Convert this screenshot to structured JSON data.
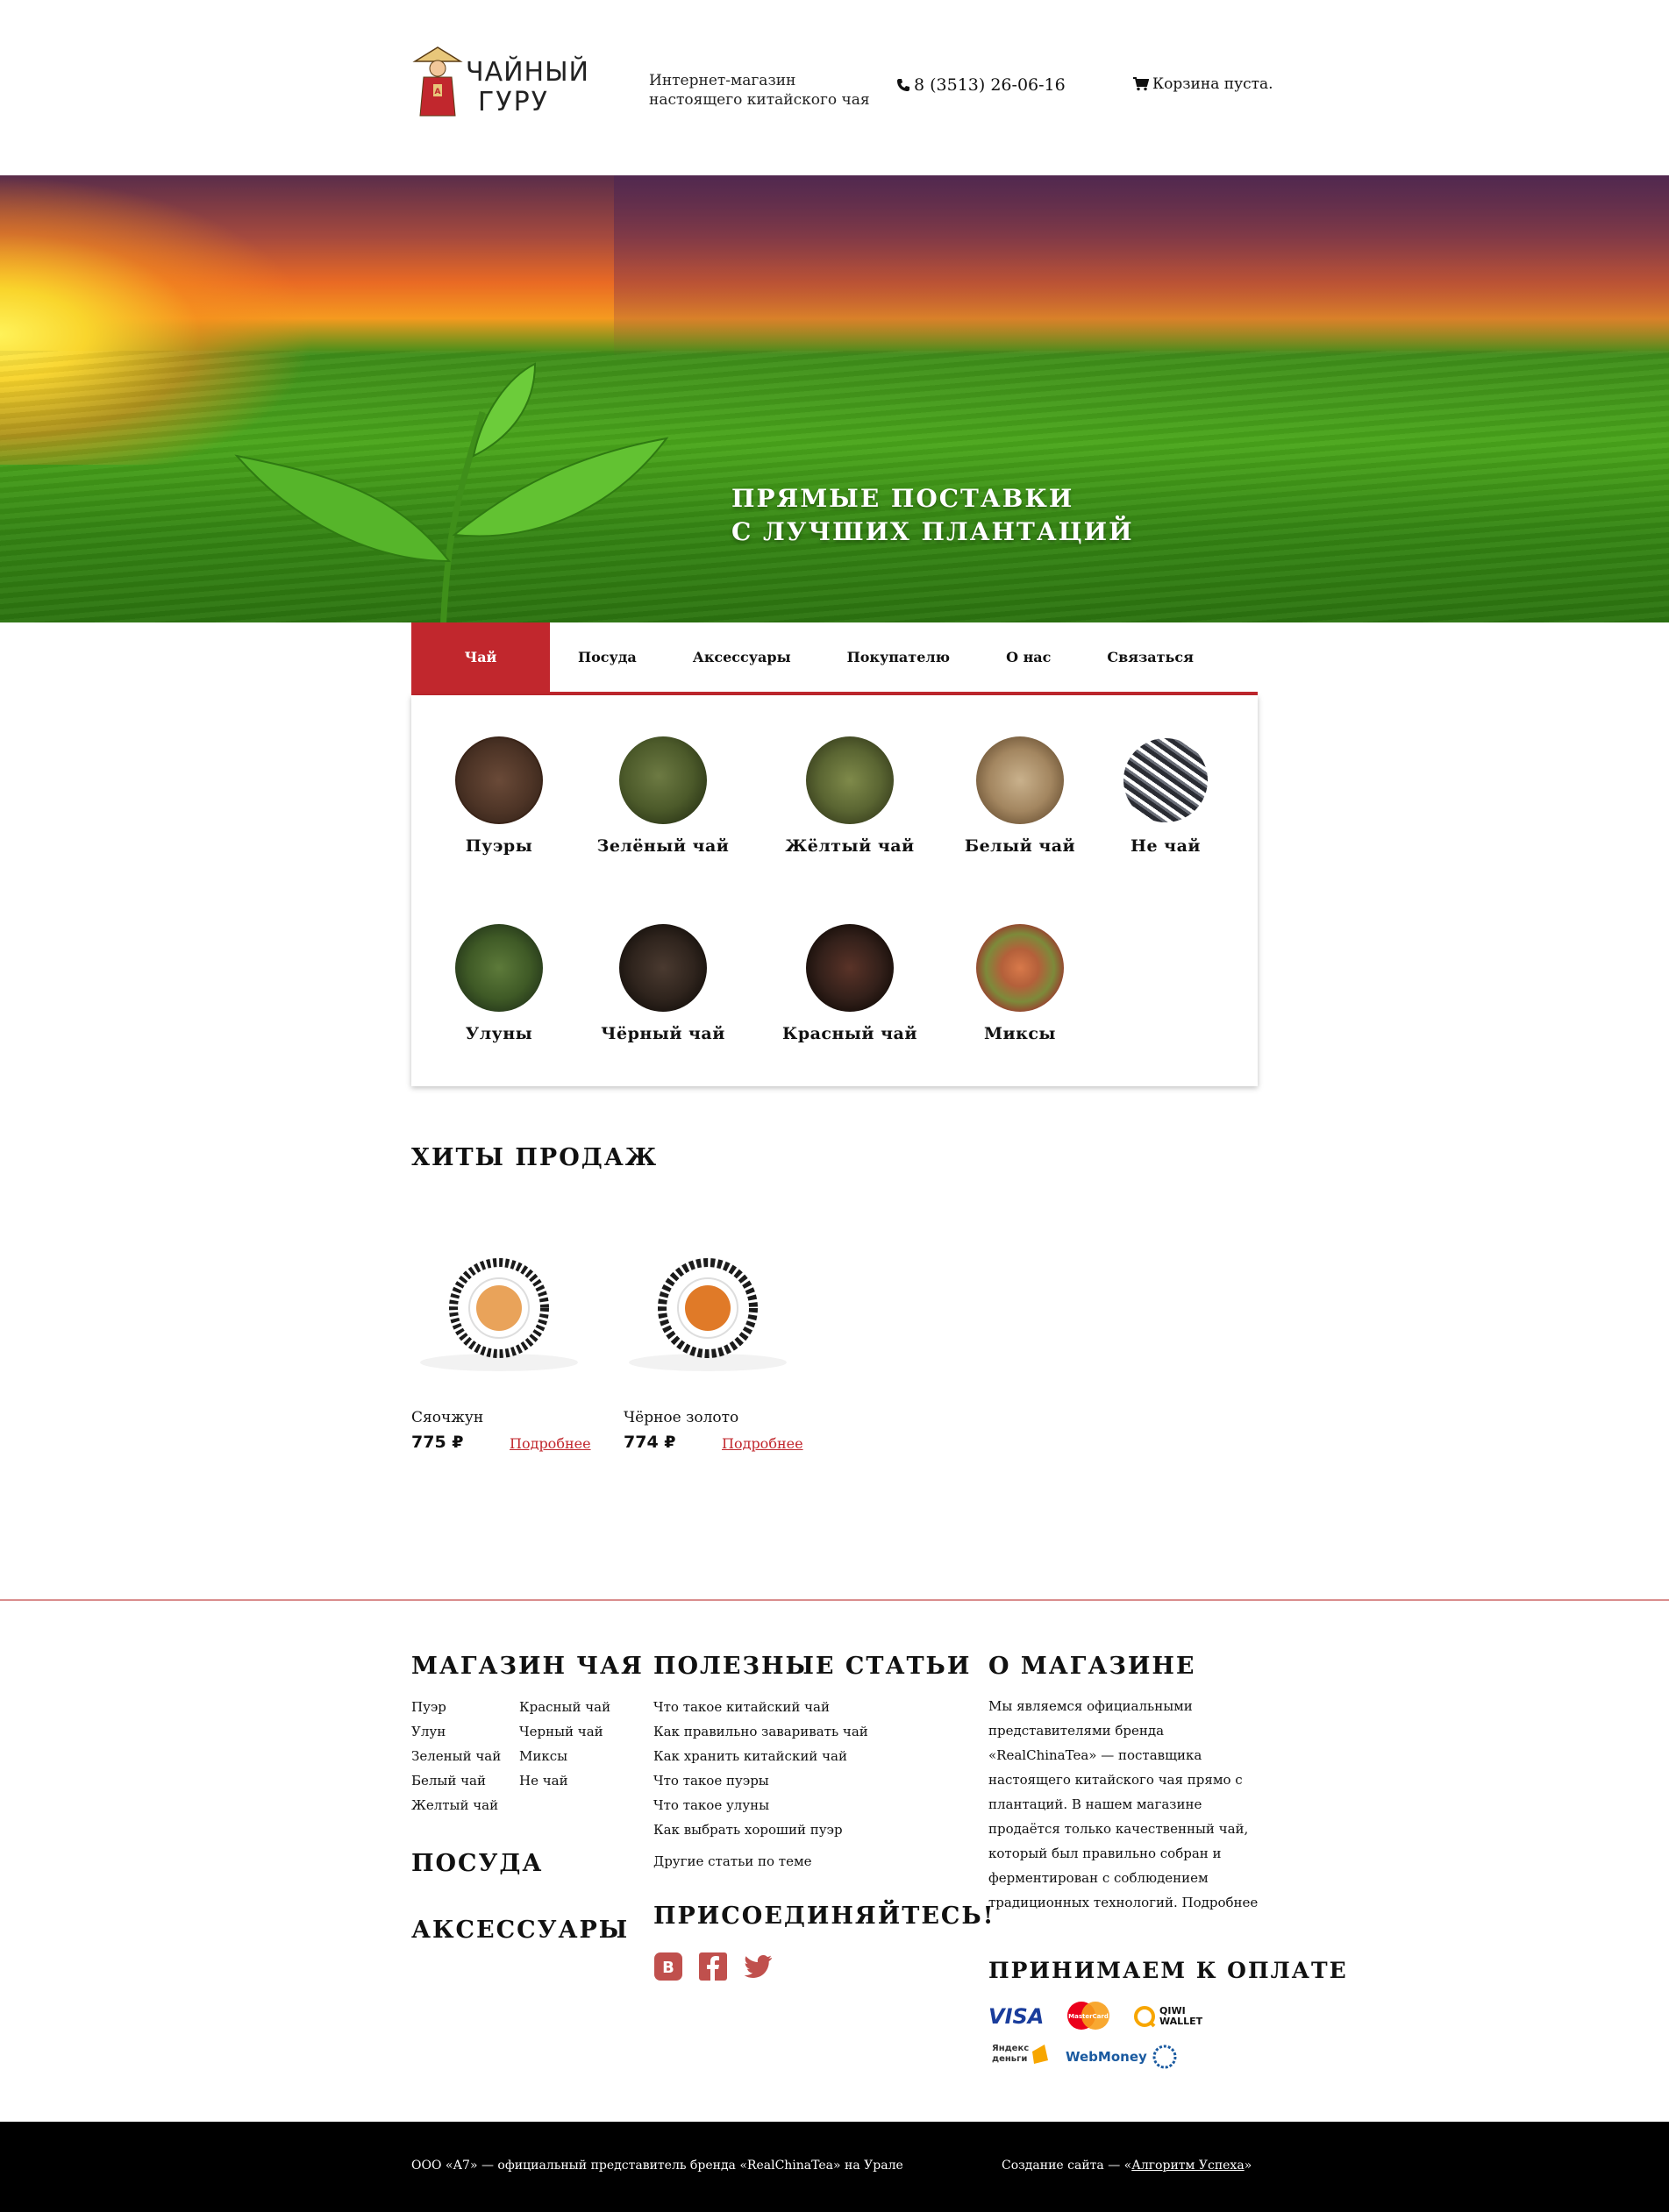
{
  "header": {
    "logo_text_1": "ЧАЙНЫЙ",
    "logo_text_2": "ГУРУ",
    "tagline_1": "Интернет-магазин",
    "tagline_2": "настоящего китайского чая",
    "phone": "8 (3513) 26-06-16",
    "cart": "Корзина пуста."
  },
  "hero": {
    "line1": "ПРЯМЫЕ ПОСТАВКИ",
    "line2": "С ЛУЧШИХ ПЛАНТАЦИЙ"
  },
  "nav": {
    "items": [
      {
        "label": "Чай"
      },
      {
        "label": "Посуда"
      },
      {
        "label": "Аксессуары"
      },
      {
        "label": "Покупателю"
      },
      {
        "label": "О нас"
      },
      {
        "label": "Связаться"
      }
    ]
  },
  "categories": [
    {
      "label": "Пуэры"
    },
    {
      "label": "Зелёный чай"
    },
    {
      "label": "Жёлтый чай"
    },
    {
      "label": "Белый чай"
    },
    {
      "label": "Не чай"
    },
    {
      "label": "Улуны"
    },
    {
      "label": "Чёрный чай"
    },
    {
      "label": "Красный чай"
    },
    {
      "label": "Миксы"
    }
  ],
  "hits": {
    "title": "ХИТЫ ПРОДАЖ",
    "products": [
      {
        "name": "Сяочжун",
        "price": "775 ₽",
        "more": "Подробнее"
      },
      {
        "name": "Чёрное золото",
        "price": "774 ₽",
        "more": "Подробнее"
      }
    ]
  },
  "footer": {
    "shop_title": "МАГАЗИН ЧАЯ",
    "shop_links_col1": [
      "Пуэр",
      "Улун",
      "Зеленый чай",
      "Белый чай",
      "Желтый чай"
    ],
    "shop_links_col2": [
      "Красный чай",
      "Черный чай",
      "Миксы",
      "Не чай"
    ],
    "dishes_title": "ПОСУДА",
    "accessories_title": "АКСЕССУАРЫ",
    "articles_title": "ПОЛЕЗНЫЕ СТАТЬИ",
    "articles": [
      "Что такое китайский чай",
      "Как правильно заваривать чай",
      "Как хранить китайский чай",
      "Что такое пуэры",
      "Что такое улуны",
      "Как выбрать хороший пуэр"
    ],
    "other_articles": "Другие статьи по теме",
    "join_title": "ПРИСОЕДИНЯЙТЕСЬ!",
    "about_title": "О МАГАЗИНЕ",
    "about_text": "Мы являемся официальными представителями бренда «RealChinaTea» — поставщика настоящего китайского чая прямо с плантаций. В нашем магазине продаётся только качественный чай, который был правильно собран и ферментирован с соблюдением традиционных технологий. Подробнее",
    "payment_title": "ПРИНИМАЕМ К ОПЛАТЕ",
    "payments": [
      "VISA",
      "MasterCard",
      "QIWI WALLET",
      "Яндекс деньги",
      "WebMoney"
    ],
    "copyright": "ООО «А7» — официальный представитель бренда «RealChinaTea» на Урале",
    "credits_prefix": "Создание сайта — «",
    "credits_link": "Алгоритм Успеха",
    "credits_suffix": "»"
  },
  "colors": {
    "accent": "#c1272d",
    "footer_bar": "#000000"
  }
}
